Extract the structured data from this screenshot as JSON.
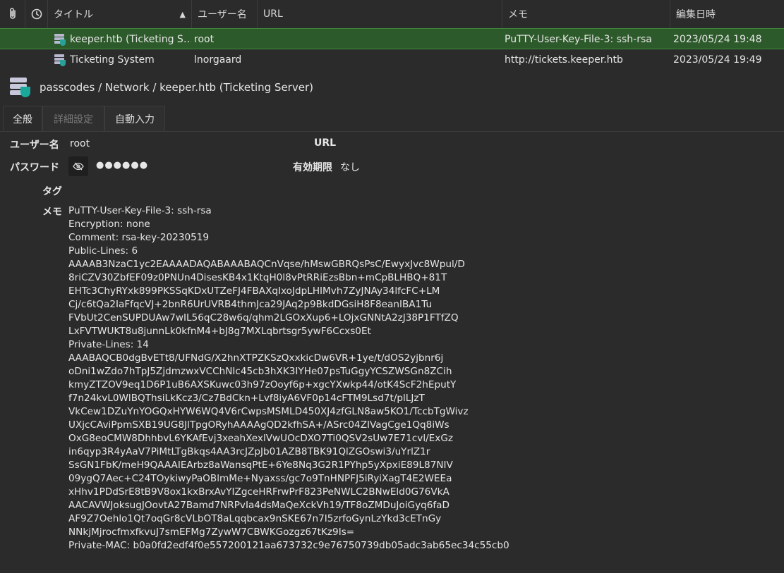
{
  "table": {
    "headers": {
      "attach_icon": "paperclip-icon",
      "time_icon": "clock-icon",
      "title": "タイトル",
      "username": "ユーザー名",
      "url": "URL",
      "notes": "メモ",
      "modified": "編集日時"
    },
    "rows": [
      {
        "title": "keeper.htb (Ticketing S…",
        "username": "root",
        "url": "",
        "notes": "PuTTY-User-Key-File-3: ssh-rsa",
        "modified": "2023/05/24 19:48"
      },
      {
        "title": "Ticketing System",
        "username": "lnorgaard",
        "url": "http://tickets.keeper.htb",
        "notes": "",
        "modified": "2023/05/24 19:49"
      }
    ]
  },
  "breadcrumb": "passcodes / Network / keeper.htb (Ticketing Server)",
  "tabs": [
    {
      "label": "全般"
    },
    {
      "label": "詳細設定"
    },
    {
      "label": "自動入力"
    }
  ],
  "general": {
    "username_label": "ユーザー名",
    "username_value": "root",
    "url_label": "URL",
    "password_label": "パスワード",
    "password_mask": "●●●●●●",
    "expires_label": "有効期限",
    "expires_value": "なし",
    "tags_label": "タグ",
    "notes_label": "メモ",
    "notes_lines": [
      "PuTTY-User-Key-File-3: ssh-rsa",
      "Encryption: none",
      "Comment: rsa-key-20230519",
      "Public-Lines: 6",
      "AAAAB3NzaC1yc2EAAAADAQABAAABAQCnVqse/hMswGBRQsPsC/EwyxJvc8Wpul/D",
      "8riCZV30ZbfEF09z0PNUn4DisesKB4x1KtqH0l8vPtRRiEzsBbn+mCpBLHBQ+81T",
      "EHTc3ChyRYxk899PKSSqKDxUTZeFJ4FBAXqIxoJdpLHIMvh7ZyJNAy34lfcFC+LM",
      "Cj/c6tQa2IaFfqcVJ+2bnR6UrUVRB4thmJca29JAq2p9BkdDGsiH8F8eanIBA1Tu",
      "FVbUt2CenSUPDUAw7wIL56qC28w6q/qhm2LGOxXup6+LOjxGNNtA2zJ38P1FTfZQ",
      "LxFVTWUKT8u8junnLk0kfnM4+bJ8g7MXLqbrtsgr5ywF6Ccxs0Et",
      "Private-Lines: 14",
      "AAABAQCB0dgBvETt8/UFNdG/X2hnXTPZKSzQxxkicDw6VR+1ye/t/dOS2yjbnr6j",
      "oDni1wZdo7hTpJ5ZjdmzwxVCChNIc45cb3hXK3IYHe07psTuGgyYCSZWSGn8ZCih",
      "kmyZTZOV9eq1D6P1uB6AXSKuwc03h97zOoyf6p+xgcYXwkp44/otK4ScF2hEputY",
      "f7n24kvL0WlBQThsiLkKcz3/Cz7BdCkn+Lvf8iyA6VF0p14cFTM9Lsd7t/plLJzT",
      "VkCew1DZuYnYOGQxHYW6WQ4V6rCwpsMSMLD450XJ4zfGLN8aw5KO1/TccbTgWivz",
      "UXjcCAviPpmSXB19UG8JlTpgORyhAAAAgQD2kfhSA+/ASrc04ZIVagCge1Qq8iWs",
      "OxG8eoCMW8DhhbvL6YKAfEvj3xeahXexlVwUOcDXO7Ti0QSV2sUw7E71cvl/ExGz",
      "in6qyp3R4yAaV7PiMtLTgBkqs4AA3rcJZpJb01AZB8TBK91QlZGOswi3/uYrlZ1r",
      "SsGN1FbK/meH9QAAAIEArbz8aWansqPtE+6Ye8Nq3G2R1PYhp5yXpxiE89L87NIV",
      "09ygQ7Aec+C24TOykiwyPaOBlmMe+Nyaxss/gc7o9TnHNPFJ5iRyiXagT4E2WEEa",
      "xHhv1PDdSrE8tB9V8ox1kxBrxAvYIZgceHRFrwPrF823PeNWLC2BNwEld0G76VkA",
      "AACAVWJoksugJOovtA27Bamd7NRPvIa4dsMaQeXckVh19/TF8oZMDuJoiGyq6faD",
      "AF9Z7Oehlo1Qt7oqGr8cVLbOT8aLqqbcax9nSKE67n7I5zrfoGynLzYkd3cETnGy",
      "NNkjMjrocfmxfkvuJ7smEFMg7ZywW7CBWKGozgz67tKz9Is=",
      "Private-MAC: b0a0fd2edf4f0e557200121aa673732c9e76750739db05adc3ab65ec34c55cb0"
    ]
  },
  "colors": {
    "selected_row": "#2d5a2a",
    "shield": "#1aa89a"
  }
}
